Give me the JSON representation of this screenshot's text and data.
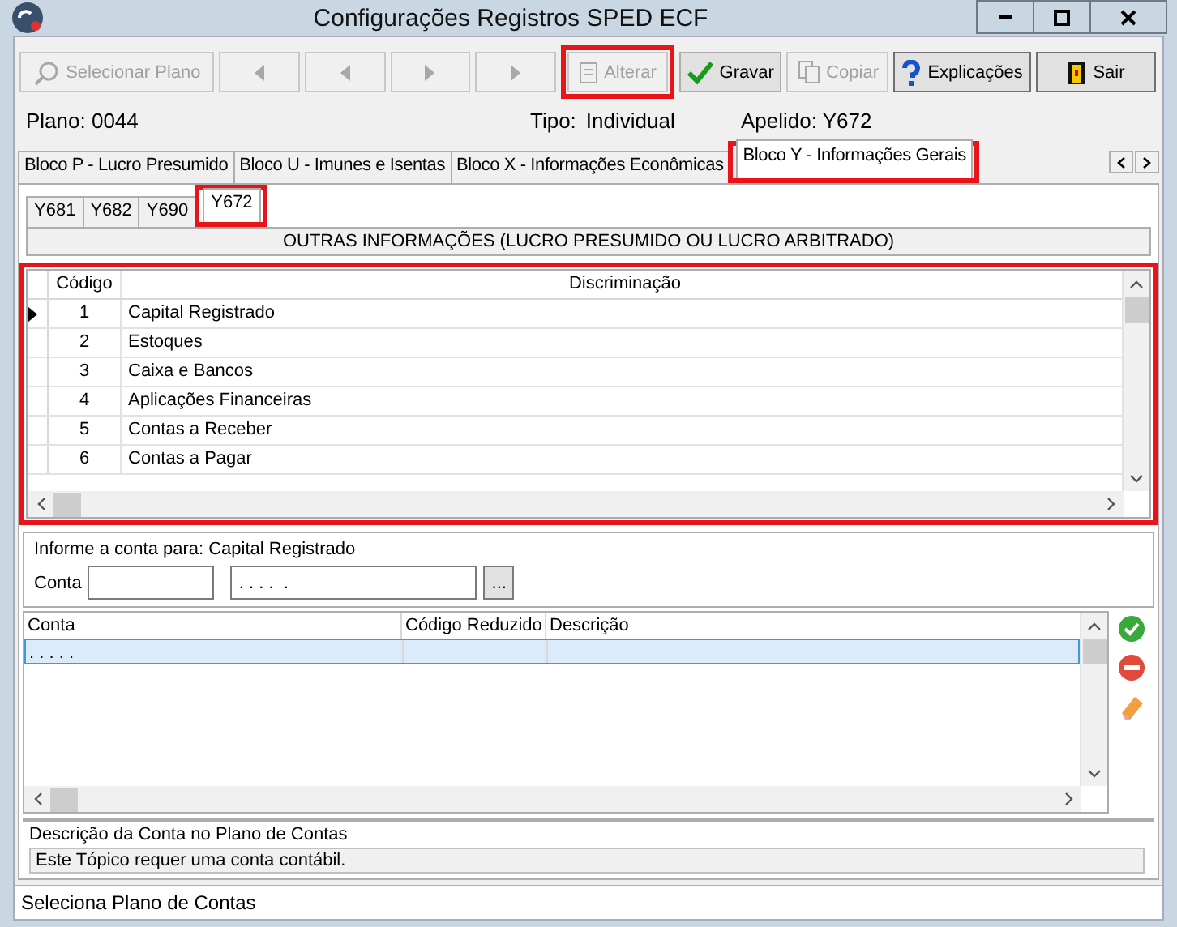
{
  "window": {
    "title": "Configurações Registros SPED ECF"
  },
  "toolbar": [
    {
      "kind": "search",
      "label": "Selecionar Plano",
      "disabled": true,
      "highlighted": false
    },
    {
      "kind": "first",
      "disabled": true,
      "highlighted": false
    },
    {
      "kind": "prev",
      "disabled": true,
      "highlighted": false
    },
    {
      "kind": "next",
      "disabled": true,
      "highlighted": false
    },
    {
      "kind": "last",
      "disabled": true,
      "highlighted": false
    },
    {
      "kind": "edit",
      "label": "Alterar",
      "disabled": true,
      "highlighted": true
    },
    {
      "kind": "save",
      "label": "Gravar",
      "disabled": false,
      "highlighted": false
    },
    {
      "kind": "copy",
      "label": "Copiar",
      "disabled": true,
      "highlighted": false
    },
    {
      "kind": "help",
      "label": "Explicações",
      "disabled": false,
      "highlighted": false
    },
    {
      "kind": "exit",
      "label": "Sair",
      "disabled": false,
      "highlighted": false
    }
  ],
  "info": {
    "plano": "Plano: 0044",
    "tipo_label": "Tipo:",
    "tipo": "Individual",
    "apelido": "Apelido: Y672"
  },
  "tabs": [
    {
      "label": "Bloco P - Lucro Presumido",
      "selected": false,
      "highlighted": false
    },
    {
      "label": "Bloco U - Imunes e Isentas",
      "selected": false,
      "highlighted": false
    },
    {
      "label": "Bloco X - Informações  Econômicas",
      "selected": false,
      "highlighted": false
    },
    {
      "label": "Bloco Y - Informações Gerais",
      "selected": true,
      "highlighted": true
    }
  ],
  "subtabs": [
    {
      "label": "Y681",
      "selected": false,
      "highlighted": false
    },
    {
      "label": "Y682",
      "selected": false,
      "highlighted": false
    },
    {
      "label": "Y690",
      "selected": false,
      "highlighted": false
    },
    {
      "label": "Y672",
      "selected": true,
      "highlighted": true
    }
  ],
  "section_title": "OUTRAS INFORMAÇÕES (LUCRO PRESUMIDO OU LUCRO ARBITRADO)",
  "grid": {
    "highlighted": true,
    "columns": [
      "Código",
      "Discriminação"
    ],
    "rows": [
      {
        "code": "1",
        "name": "Capital Registrado",
        "selected": true
      },
      {
        "code": "2",
        "name": "Estoques",
        "selected": false
      },
      {
        "code": "3",
        "name": "Caixa e Bancos",
        "selected": false
      },
      {
        "code": "4",
        "name": "Aplicações Financeiras",
        "selected": false
      },
      {
        "code": "5",
        "name": "Contas a Receber",
        "selected": false
      },
      {
        "code": "6",
        "name": "Contas a Pagar",
        "selected": false
      }
    ]
  },
  "account_panel": {
    "prompt": "Informe a conta para: Capital Registrado",
    "label": "Conta",
    "mask_value": ". . . .  .",
    "browse": "..."
  },
  "accounts": {
    "columns": [
      "Conta",
      "Código Reduzido",
      "Descrição"
    ],
    "rows": [
      {
        "conta": ". . . .  .",
        "selected": true
      }
    ]
  },
  "description": {
    "label": "Descrição da Conta no Plano de Contas",
    "text": "Este Tópico requer uma conta contábil."
  },
  "status_bar": "Seleciona Plano de Contas"
}
